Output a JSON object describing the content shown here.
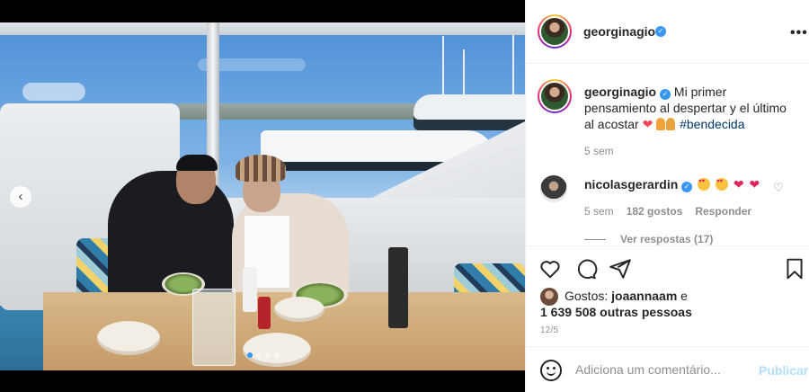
{
  "author": {
    "username": "georginagio",
    "verified": true
  },
  "caption": {
    "username": "georginagio",
    "text": "Mi primer pensamiento al despertar y el último al acostar",
    "heart": "❤",
    "hashtag": "#bendecida",
    "time": "5 sem"
  },
  "comments": [
    {
      "username": "nicolasgerardin",
      "verified": true,
      "time": "5 sem",
      "likes": "182 gostos",
      "reply": "Responder",
      "view_replies": "Ver respostas (17)"
    }
  ],
  "actions": {
    "like": "heart-icon",
    "comment": "comment-icon",
    "share": "share-icon",
    "save": "bookmark-icon"
  },
  "likes": {
    "prefix": "Gostos:",
    "user": "joaannaam",
    "joiner": "e",
    "others": "1 639 508 outras pessoas"
  },
  "date": "12/5",
  "comment_box": {
    "placeholder": "Adiciona um comentário...",
    "publish": "Publicar"
  },
  "carousel": {
    "prev": "‹",
    "count": 4,
    "active": 0
  },
  "colors": {
    "accent": "#3897f0",
    "link": "#00376b",
    "muted": "#8e8e8e",
    "publish_disabled": "#b2dffc",
    "like_red": "#ed4956"
  }
}
